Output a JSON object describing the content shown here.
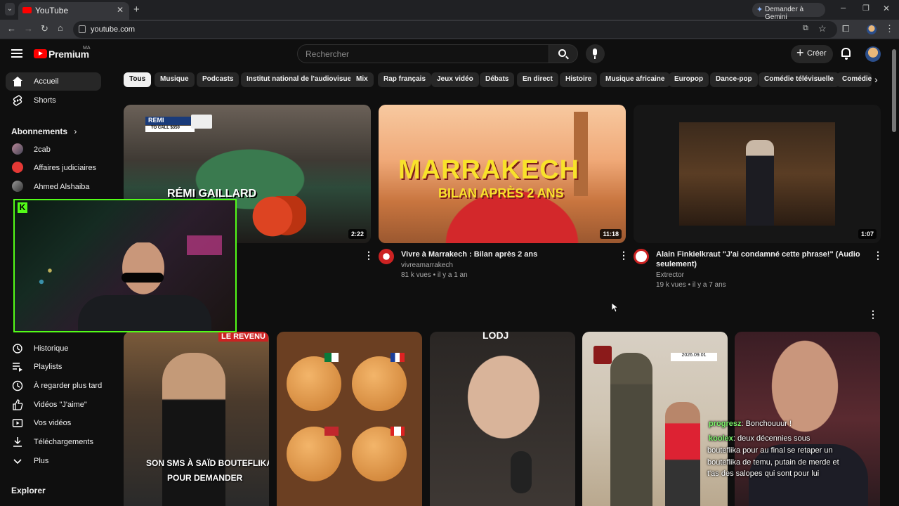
{
  "browser": {
    "tab_title": "YouTube",
    "url": "youtube.com",
    "gemini_label": "Demander à Gemini"
  },
  "header": {
    "logo_text": "Premium",
    "country_code": "MA",
    "search_placeholder": "Rechercher",
    "create_label": "Créer"
  },
  "sidebar": {
    "home": "Accueil",
    "shorts": "Shorts",
    "subscriptions_heading": "Abonnements",
    "subscriptions": [
      "2cab",
      "Affaires judiciaires",
      "Ahmed Alshaiba"
    ],
    "you_items": [
      "Historique",
      "Playlists",
      "À regarder plus tard",
      "Vidéos \"J'aime\"",
      "Vos vidéos",
      "Téléchargements",
      "Plus"
    ],
    "explore_heading": "Explorer"
  },
  "chips": [
    "Tous",
    "Musique",
    "Podcasts",
    "Institut national de l'audiovisuel",
    "Mix",
    "Rap français",
    "Jeux vidéo",
    "Débats",
    "En direct",
    "Histoire",
    "Musique africaine",
    "Europop",
    "Dance-pop",
    "Comédie télévisuelle",
    "Comédies"
  ],
  "videos": [
    {
      "thumb_text": "RÉMI GAILLARD",
      "overlay_name": "REMI",
      "overlay_sub": "TO CALL $350",
      "duration": "2:22"
    },
    {
      "thumb_title": "MARRAKECH",
      "thumb_subtitle": "BILAN APRÈS 2 ANS",
      "duration": "11:18",
      "title": "Vivre à Marrakech : Bilan après 2 ans",
      "channel": "vivreamarrakech",
      "stats": "81 k vues • il y a 1 an"
    },
    {
      "duration": "1:07",
      "title_line1": "Alain Finkielkraut \"J'ai condamné cette phrase!\" (Audio",
      "title_line2": "seulement)",
      "channel": "Extrector",
      "stats": "19 k vues • il y a 7 ans"
    }
  ],
  "shorts": [
    {
      "top_text": "LE REVENU",
      "caption_line1": "SON SMS À SAÏD BOUTEFLIKA",
      "caption_line2": "POUR DEMANDER"
    },
    {
      "kind": "burgers"
    },
    {
      "top_text": "LODJ"
    },
    {
      "kind": "soldiers",
      "date": "2026.09.01"
    },
    {
      "kind": "talk"
    }
  ],
  "chat": {
    "messages": [
      {
        "user": "progresz",
        "text": ": Bonchouuur !"
      },
      {
        "user": "koolex",
        "text": ": deux décennies sous"
      },
      {
        "user": "",
        "text": "bouteflika pour au final se retaper un"
      },
      {
        "user": "",
        "text": "bouteflika de temu, putain de merde et"
      },
      {
        "user": "",
        "text": "t'as des salopes qui sont pour lui"
      }
    ]
  },
  "icons": {
    "webcam_badge": "K"
  },
  "colors": {
    "background": "#0f0f0f",
    "youtube_red": "#ff0000",
    "kick_green": "#53fc18",
    "chip_selected": "#f1f1f1"
  }
}
